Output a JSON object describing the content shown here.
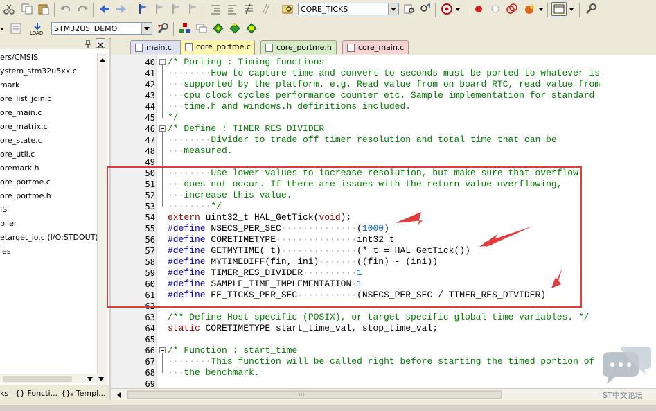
{
  "toolbar1": {
    "target_combo": "CORE_TICKS"
  },
  "toolbar2": {
    "project_combo": "STM32U5_DEMO",
    "load_label": "LOAD"
  },
  "panel": {
    "items": [
      "ers/CMSIS",
      "ystem_stm32u5xx.c",
      "mark",
      "ore_list_join.c",
      "ore_main.c",
      "ore_matrix.c",
      "ore_state.c",
      "ore_util.c",
      "oremark.h",
      "ore_portme.c",
      "ore_portme.h",
      "IS",
      "piler",
      "etarget_io.c (I/O:STDOUT)",
      "ies"
    ],
    "tabs": [
      {
        "label": "ks",
        "icon": "project-icon"
      },
      {
        "label": "{} Functi...",
        "icon": "functions-icon"
      },
      {
        "label": "{}ₐ Templ...",
        "icon": "templates-icon"
      }
    ]
  },
  "editor_tabs": [
    {
      "label": "main.c",
      "active": false,
      "color": "#dde3f5"
    },
    {
      "label": "core_portme.c",
      "active": true,
      "color": "#fff6b0"
    },
    {
      "label": "core_portme.h",
      "active": false,
      "color": "#d6ecc5"
    },
    {
      "label": "core_main.c",
      "active": false,
      "color": "#f6d2d2"
    }
  ],
  "code_lines": [
    {
      "n": "40",
      "segs": [
        [
          "cm",
          "/* Porting : Timing functions"
        ]
      ]
    },
    {
      "n": "41",
      "segs": [
        [
          "dots",
          "········"
        ],
        [
          "cm",
          "How to capture time and convert to seconds must be ported to whatever is"
        ]
      ]
    },
    {
      "n": "42",
      "segs": [
        [
          "dots",
          "···"
        ],
        [
          "cm",
          "supported by the platform. e.g. Read value from on board RTC, read value from"
        ]
      ]
    },
    {
      "n": "43",
      "segs": [
        [
          "dots",
          "···"
        ],
        [
          "cm",
          "cpu clock cycles performance counter etc. Sample implementation for standard"
        ]
      ]
    },
    {
      "n": "44",
      "segs": [
        [
          "dots",
          "···"
        ],
        [
          "cm",
          "time.h and windows.h definitions included."
        ]
      ]
    },
    {
      "n": "45",
      "segs": [
        [
          "cm",
          "*/"
        ]
      ]
    },
    {
      "n": "46",
      "segs": [
        [
          "cm",
          "/* Define : TIMER_RES_DIVIDER"
        ]
      ]
    },
    {
      "n": "47",
      "segs": [
        [
          "dots",
          "········"
        ],
        [
          "cm",
          "Divider to trade off timer resolution and total time that can be"
        ]
      ]
    },
    {
      "n": "48",
      "segs": [
        [
          "dots",
          "···"
        ],
        [
          "cm",
          "measured."
        ]
      ]
    },
    {
      "n": "49",
      "segs": []
    },
    {
      "n": "50",
      "segs": [
        [
          "dots",
          "········"
        ],
        [
          "cm",
          "Use lower values to increase resolution, but make sure that overflow"
        ]
      ]
    },
    {
      "n": "51",
      "segs": [
        [
          "dots",
          "···"
        ],
        [
          "cm",
          "does not occur. If there are issues with the return value overflowing,"
        ]
      ]
    },
    {
      "n": "52",
      "segs": [
        [
          "dots",
          "···"
        ],
        [
          "cm",
          "increase this value."
        ]
      ]
    },
    {
      "n": "53",
      "segs": [
        [
          "dots",
          "········"
        ],
        [
          "cm",
          "*/"
        ]
      ]
    },
    {
      "n": "54",
      "segs": [
        [
          "kw",
          "extern"
        ],
        [
          "tx",
          " uint32_t HAL_GetTick("
        ],
        [
          "kw",
          "void"
        ],
        [
          "tx",
          ");"
        ]
      ]
    },
    {
      "n": "55",
      "segs": [
        [
          "pp",
          "#define"
        ],
        [
          "tx",
          " NSECS_PER_SEC"
        ],
        [
          "dots",
          "··············"
        ],
        [
          "tx",
          "("
        ],
        [
          "nm",
          "1000"
        ],
        [
          "tx",
          ")"
        ]
      ]
    },
    {
      "n": "56",
      "segs": [
        [
          "pp",
          "#define"
        ],
        [
          "tx",
          " CORETIMETYPE"
        ],
        [
          "dots",
          "···············"
        ],
        [
          "tx",
          "int32_t"
        ]
      ]
    },
    {
      "n": "57",
      "segs": [
        [
          "pp",
          "#define"
        ],
        [
          "tx",
          " GETMYTIME(_t)"
        ],
        [
          "dots",
          "··············"
        ],
        [
          "tx",
          "(*_t = HAL_GetTick())"
        ]
      ]
    },
    {
      "n": "58",
      "segs": [
        [
          "pp",
          "#define"
        ],
        [
          "tx",
          " MYTIMEDIFF(fin, ini)"
        ],
        [
          "dots",
          "·······"
        ],
        [
          "tx",
          "((fin) - (ini))"
        ]
      ]
    },
    {
      "n": "59",
      "segs": [
        [
          "pp",
          "#define"
        ],
        [
          "tx",
          " TIMER_RES_DIVIDER"
        ],
        [
          "dots",
          "··········"
        ],
        [
          "nm",
          "1"
        ]
      ]
    },
    {
      "n": "60",
      "segs": [
        [
          "pp",
          "#define"
        ],
        [
          "tx",
          " SAMPLE_TIME_IMPLEMENTATION"
        ],
        [
          "dots",
          "·"
        ],
        [
          "nm",
          "1"
        ]
      ]
    },
    {
      "n": "61",
      "segs": [
        [
          "pp",
          "#define"
        ],
        [
          "tx",
          " EE_TICKS_PER_SEC"
        ],
        [
          "dots",
          "···········"
        ],
        [
          "tx",
          "(NSECS_PER_SEC / TIMER_RES_DIVIDER)"
        ]
      ]
    },
    {
      "n": "62",
      "segs": []
    },
    {
      "n": "63",
      "segs": [
        [
          "cm",
          "/** Define Host specific (POSIX), or target specific global time variables. */"
        ]
      ]
    },
    {
      "n": "64",
      "segs": [
        [
          "kw",
          "static"
        ],
        [
          "tx",
          " CORETIMETYPE start_time_val, stop_time_val;"
        ]
      ]
    },
    {
      "n": "65",
      "segs": []
    },
    {
      "n": "66",
      "segs": [
        [
          "cm",
          "/* Function : start_time"
        ]
      ]
    },
    {
      "n": "67",
      "segs": [
        [
          "dots",
          "········"
        ],
        [
          "cm",
          "This function will be called right before starting the timed portion of"
        ]
      ]
    },
    {
      "n": "68",
      "segs": [
        [
          "dots",
          "···"
        ],
        [
          "cm",
          "the benchmark."
        ]
      ]
    },
    {
      "n": "69",
      "segs": []
    }
  ],
  "watermark": {
    "text": "ST中文论坛"
  },
  "colors": {
    "accent_red": "#e33b3b",
    "comment": "#007f00",
    "keyword": "#9a0000",
    "preproc": "#0000c0"
  }
}
